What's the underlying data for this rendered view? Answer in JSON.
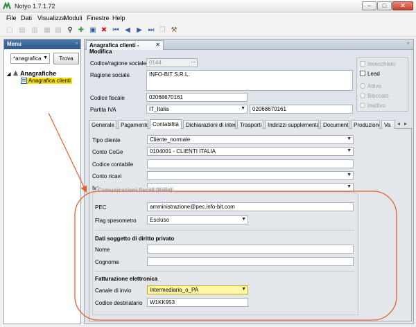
{
  "window": {
    "title": "Notyo 1.7.1.72"
  },
  "menubar": [
    "File",
    "Dati",
    "Visualizza",
    "Moduli",
    "Finestre",
    "Help"
  ],
  "left_panel": {
    "title": "Menu",
    "search_value": "*anagrafica",
    "search_button": "Trova",
    "tree_root": "Anagrafiche",
    "tree_leaf": "Anagrafica clienti"
  },
  "doc_tab": {
    "label": "Anagrafica clienti - Modifica"
  },
  "form": {
    "codice_label": "Codice/ragione sociale",
    "codice_value": "0144",
    "ragione_label": "Ragione sociale",
    "ragione_value": "INFO-BIT S.R.L.",
    "cf_label": "Codice fiscale",
    "cf_value": "02068670161",
    "piva_label": "Partita IVA",
    "piva_country": "IT_Italia",
    "piva_value": "02068670161"
  },
  "flags": {
    "invecchiato": "Invecchiato",
    "lead": "Lead",
    "attivo": "Attivo",
    "bloccato": "Bloccato",
    "inattivo": "Inattivo"
  },
  "tabs": [
    "Generale",
    "Pagamento",
    "Contabilità",
    "Dichiarazioni di intento",
    "Trasporti",
    "Indirizzi supplementari",
    "Documenti",
    "Produzione",
    "Va"
  ],
  "contabilita": {
    "tipo_label": "Tipo cliente",
    "tipo_value": "Cliente_normale",
    "coge_label": "Conto CoGe",
    "coge_value": "0104001 - CLIENTI ITALIA",
    "contabile_label": "Codice contabile",
    "contabile_value": "",
    "ricavi_label": "Conto ricavi",
    "ricavi_value": "",
    "iva_label": "Iva",
    "iva_value": ""
  },
  "comunicazioni": {
    "group_title": "Comunicazioni fiscali (Italia)",
    "pec_label": "PEC",
    "pec_value": "amministrazione@pec.info-bit.com",
    "spesometro_label": "Flag spesometro",
    "spesometro_value": "Escluso",
    "privato_title": "Dati soggetto di diritto privato",
    "nome_label": "Nome",
    "nome_value": "",
    "cognome_label": "Cognome",
    "cognome_value": "",
    "fattura_title": "Fatturazione elettronica",
    "canale_label": "Canale di invio",
    "canale_value": "Intermediario_o_PA",
    "destinatario_label": "Codice destinatario",
    "destinatario_value": "W1KK953"
  },
  "colors": {
    "panel_header": "#3a6396",
    "highlight": "#f7e000",
    "annotation": "#e3622a"
  }
}
